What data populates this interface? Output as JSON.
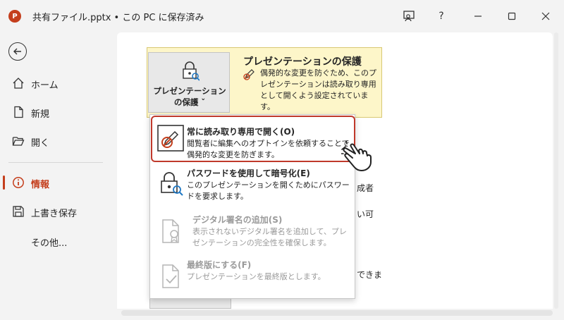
{
  "titlebar": {
    "app_logo": "P",
    "title": "共有ファイル.pptx • この PC に保存済み",
    "icons": [
      "presenter-icon",
      "help-icon",
      "minimize-icon",
      "maximize-icon",
      "close-icon"
    ],
    "help_label": "?"
  },
  "nav": {
    "items": [
      {
        "label": "ホーム",
        "icon": "home-icon"
      },
      {
        "label": "新規",
        "icon": "new-document-icon"
      },
      {
        "label": "開く",
        "icon": "folder-open-icon"
      },
      {
        "label": "情報",
        "icon": "info-icon",
        "active": true
      },
      {
        "label": "上書き保存",
        "icon": "save-icon"
      },
      {
        "label": "その他..."
      }
    ]
  },
  "protect": {
    "button_line1": "プレゼンテーション",
    "button_line2": "の保護 ˇ",
    "title": "プレゼンテーションの保護",
    "description": "偶発的な変更を防ぐため、このプレゼンテーションは読み取り専用として開くよう設定されています。"
  },
  "background_fragments": {
    "frag1": "成者",
    "frag2": "い可",
    "frag3": "できま"
  },
  "menu": {
    "items": [
      {
        "title": "常に読み取り専用で開く(O)",
        "desc": "閲覧者に編集へのオプトインを依頼することで偶発的な変更を防ぎます。",
        "enabled": true
      },
      {
        "title": "パスワードを使用して暗号化(E)",
        "desc": "このプレゼンテーションを開くためにパスワードを要求します。",
        "enabled": true
      },
      {
        "title": "デジタル署名の追加(S)",
        "desc": "表示されないデジタル署名を追加して、プレゼンテーションの完全性を確保します。",
        "enabled": false
      },
      {
        "title": "最終版にする(F)",
        "desc": "プレゼンテーションを最終版とします。",
        "enabled": false
      }
    ]
  },
  "colors": {
    "accent": "#c43e1c",
    "highlight": "#c0392b",
    "panel_bg": "#fdf6c9"
  }
}
